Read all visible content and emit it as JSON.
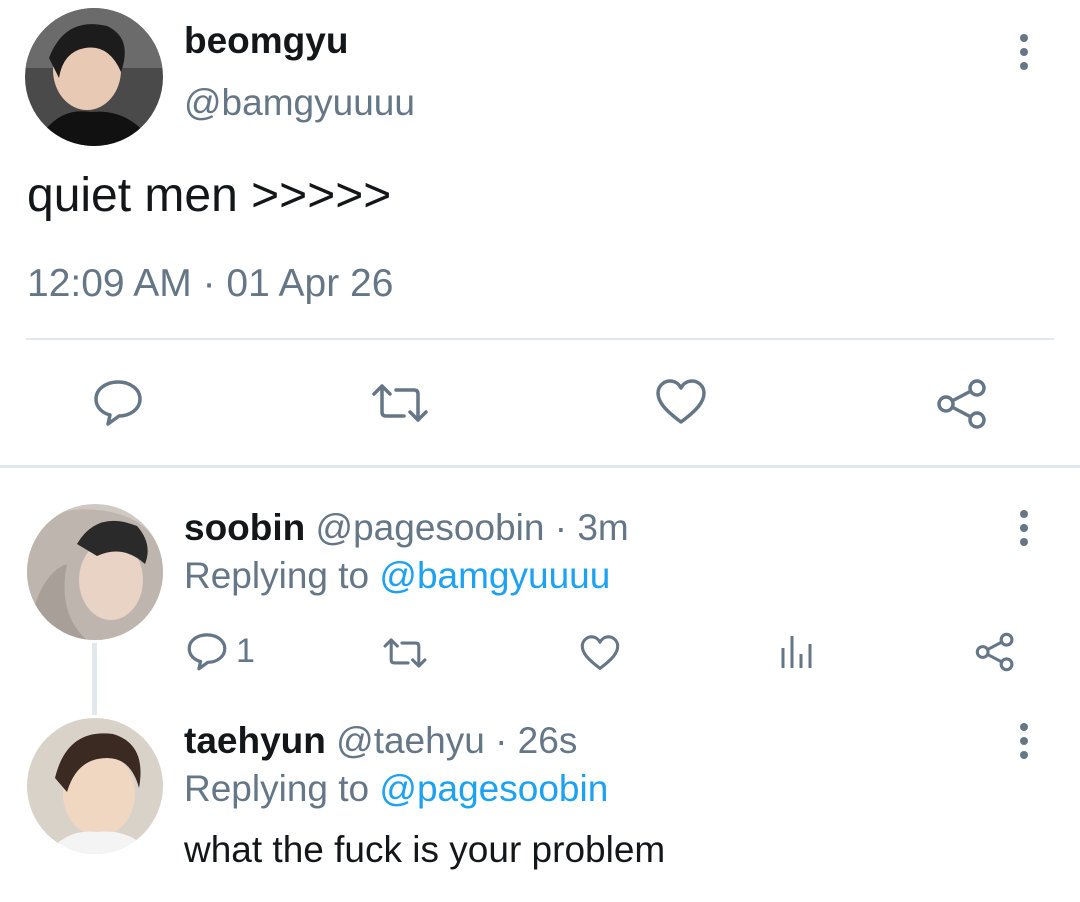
{
  "main_tweet": {
    "display_name": "beomgyu",
    "handle": "@bamgyuuuu",
    "text": "quiet men >>>>>",
    "timestamp": "12:09 AM · 01 Apr 26",
    "actions": {
      "reply_icon": "speech-bubble-icon",
      "retweet_icon": "retweet-icon",
      "like_icon": "heart-icon",
      "share_icon": "share-icon"
    }
  },
  "replies": [
    {
      "display_name": "soobin",
      "handle": "@pagesoobin",
      "time": "· 3m",
      "replying_prefix": "Replying to",
      "replying_to": "@bamgyuuuu",
      "reply_count": "1"
    },
    {
      "display_name": "taehyun",
      "handle": "@taehyu",
      "time": "· 26s",
      "replying_prefix": "Replying to",
      "replying_to": "@pagesoobin",
      "text": "what the fuck is your problem"
    }
  ],
  "colors": {
    "text_primary": "#14171a",
    "text_muted": "#657786",
    "link": "#1da1f2",
    "divider": "#e1e8ed"
  }
}
